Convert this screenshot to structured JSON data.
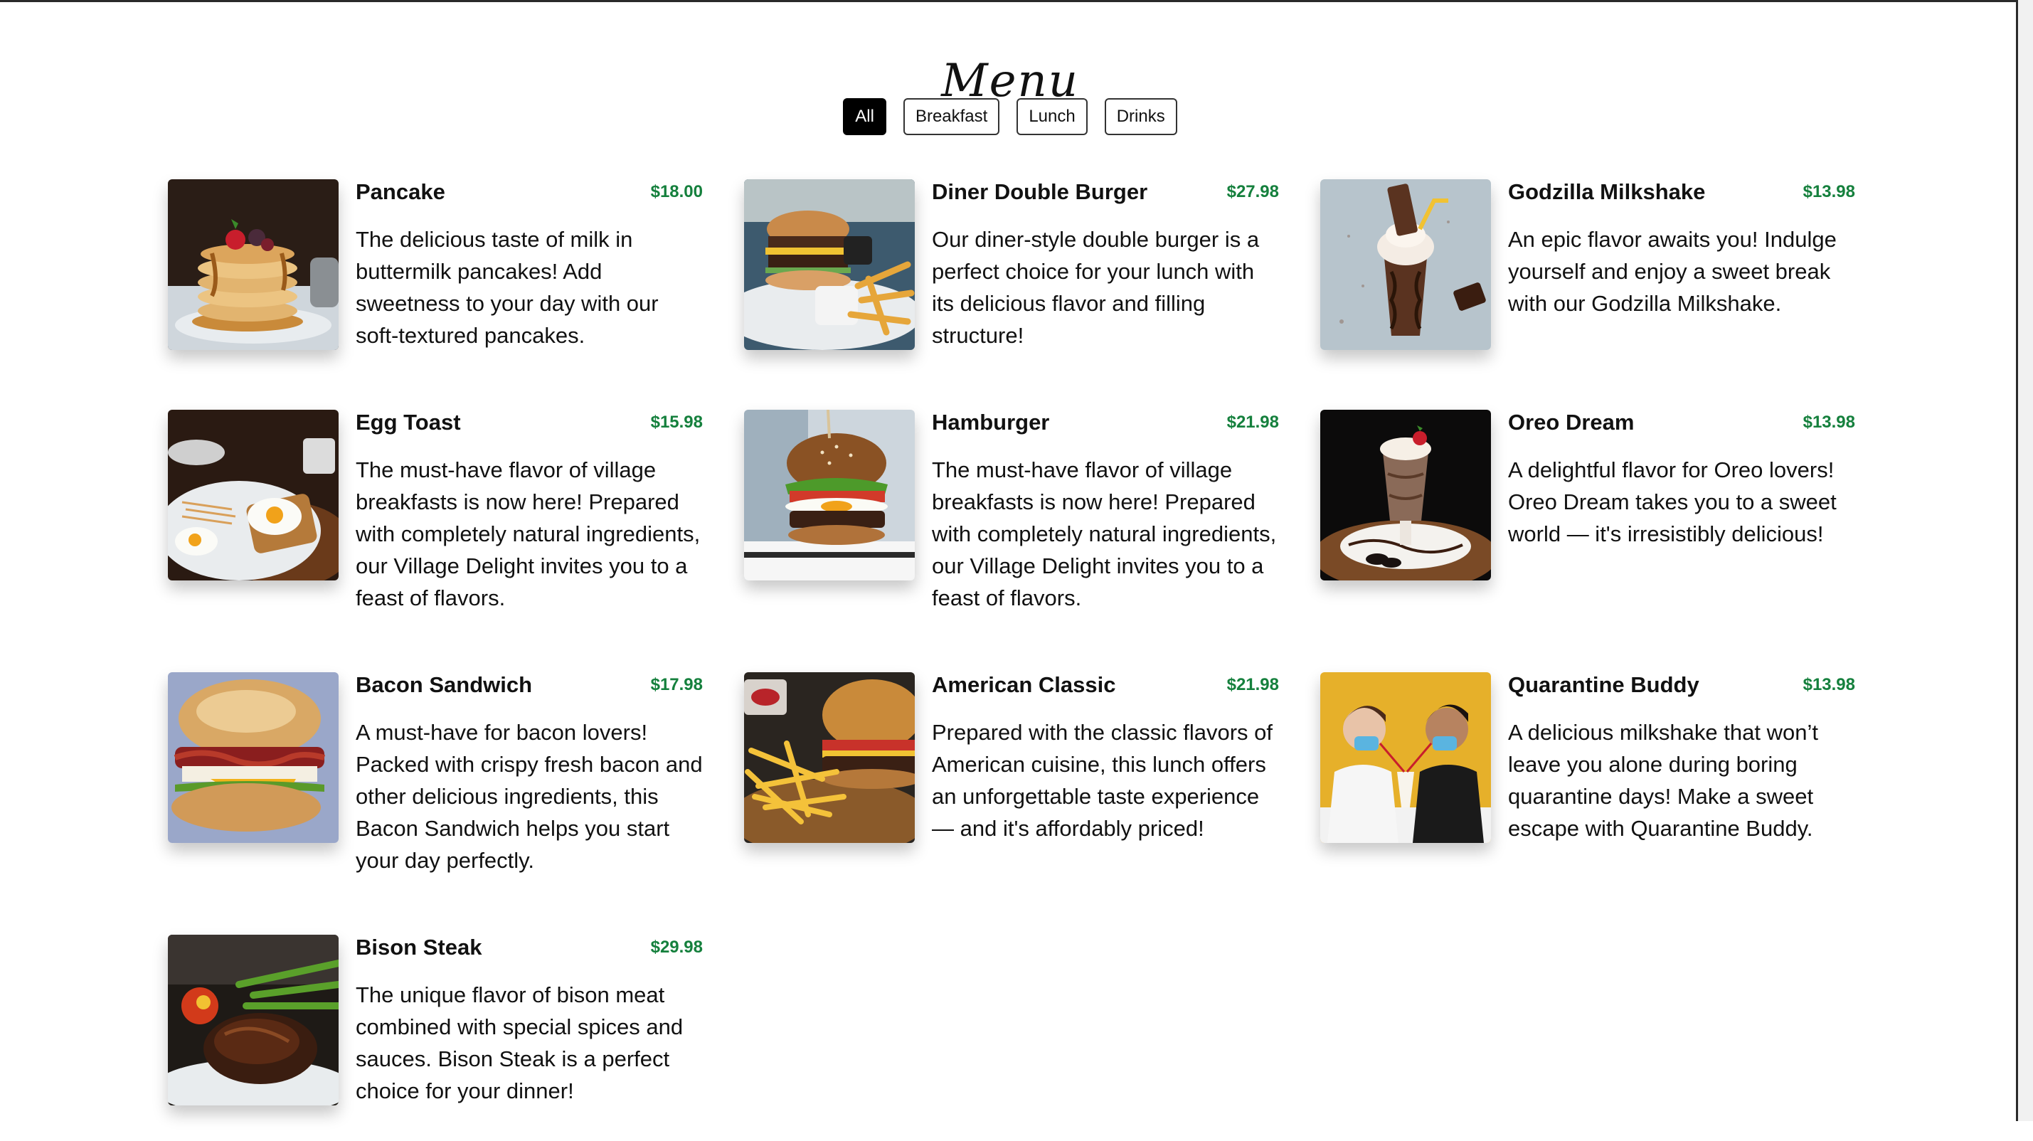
{
  "page": {
    "title": "Menu"
  },
  "filters": [
    "All",
    "Breakfast",
    "Lunch",
    "Drinks"
  ],
  "active_filter": "All",
  "colors": {
    "price": "#15803d",
    "active_filter_bg": "#000000"
  },
  "items": [
    {
      "name": "Pancake",
      "price": "$18.00",
      "description": "The delicious taste of milk in buttermilk pancakes! Add sweetness to your day with our soft-textured pancakes.",
      "image": "pancake-photo"
    },
    {
      "name": "Diner Double Burger",
      "price": "$27.98",
      "description": "Our diner-style double burger is a perfect choice for your lunch with its delicious flavor and filling structure!",
      "image": "double-burger-photo"
    },
    {
      "name": "Godzilla Milkshake",
      "price": "$13.98",
      "description": "An epic flavor awaits you! Indulge yourself and enjoy a sweet break with our Godzilla Milkshake.",
      "image": "milkshake-photo"
    },
    {
      "name": "Egg Toast",
      "price": "$15.98",
      "description": "The must-have flavor of village breakfasts is now here! Prepared with completely natural ingredients, our Village Delight invites you to a feast of flavors.",
      "image": "egg-toast-photo"
    },
    {
      "name": "Hamburger",
      "price": "$21.98",
      "description": "The must-have flavor of village breakfasts is now here! Prepared with completely natural ingredients, our Village Delight invites you to a feast of flavors.",
      "image": "hamburger-photo"
    },
    {
      "name": "Oreo Dream",
      "price": "$13.98",
      "description": "A delightful flavor for Oreo lovers! Oreo Dream takes you to a sweet world — it's irresistibly delicious!",
      "image": "oreo-shake-photo"
    },
    {
      "name": "Bacon Sandwich",
      "price": "$17.98",
      "description": "A must-have for bacon lovers! Packed with crispy fresh bacon and other delicious ingredients, this Bacon Sandwich helps you start your day perfectly.",
      "image": "bacon-sandwich-photo"
    },
    {
      "name": "American Classic",
      "price": "$21.98",
      "description": "Prepared with the classic flavors of American cuisine, this lunch offers an unforgettable taste experience — and it's affordably priced!",
      "image": "burger-fries-photo"
    },
    {
      "name": "Quarantine Buddy",
      "price": "$13.98",
      "description": "A delicious milkshake that won’t leave you alone during boring quarantine days! Make a sweet escape with Quarantine Buddy.",
      "image": "couple-milkshake-photo"
    },
    {
      "name": "Bison Steak",
      "price": "$29.98",
      "description": "The unique flavor of bison meat combined with special spices and sauces. Bison Steak is a perfect choice for your dinner!",
      "image": "steak-photo"
    }
  ]
}
